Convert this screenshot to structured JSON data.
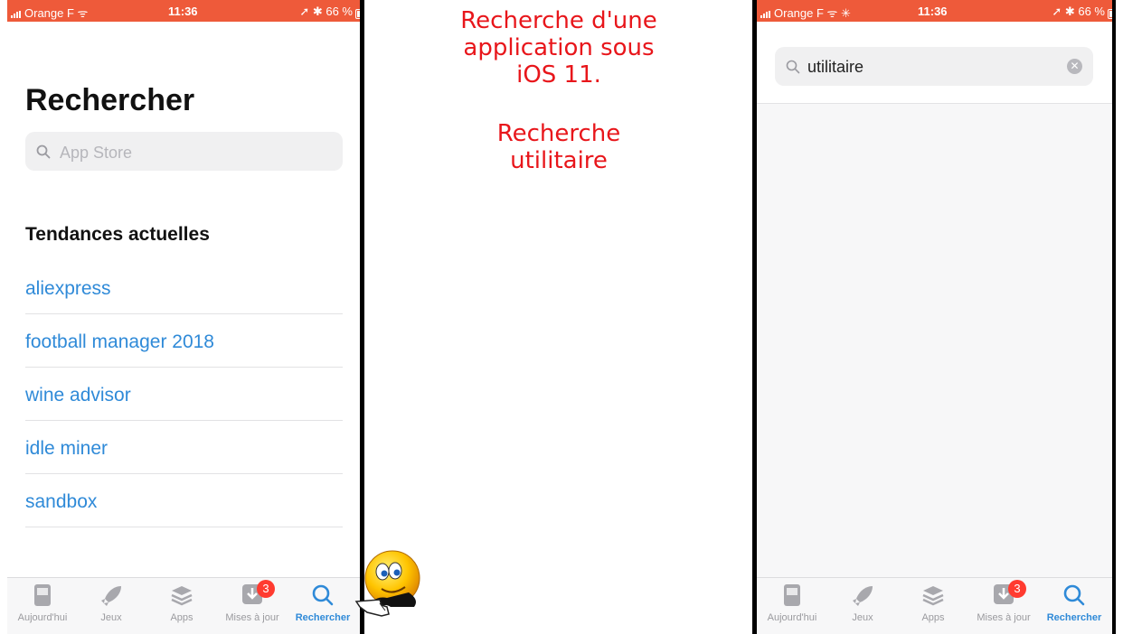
{
  "status_bar": {
    "carrier": "Orange F",
    "time": "11:36",
    "battery": "66 %"
  },
  "left": {
    "title": "Rechercher",
    "search_placeholder": "App Store",
    "trending_title": "Tendances actuelles",
    "trending": [
      "aliexpress",
      "football manager 2018",
      "wine advisor",
      "idle miner",
      "sandbox"
    ]
  },
  "caption": {
    "line1": "Recherche d'une",
    "line2": "application sous",
    "line3": "iOS 11.",
    "line4": "Recherche",
    "line5": "utilitaire"
  },
  "right": {
    "search_value": "utilitaire"
  },
  "tab_bar": {
    "today": "Aujourd'hui",
    "games": "Jeux",
    "apps": "Apps",
    "updates": "Mises à jour",
    "search": "Rechercher",
    "updates_badge": "3"
  },
  "colors": {
    "status_bar": "#ee5a3a",
    "link": "#2f8ad8",
    "caption": "#e8161b",
    "badge": "#ff3b30"
  },
  "icons": [
    "search-icon",
    "today-icon",
    "rocket-icon",
    "apps-stack-icon",
    "download-icon",
    "smiley-pointing-icon"
  ]
}
